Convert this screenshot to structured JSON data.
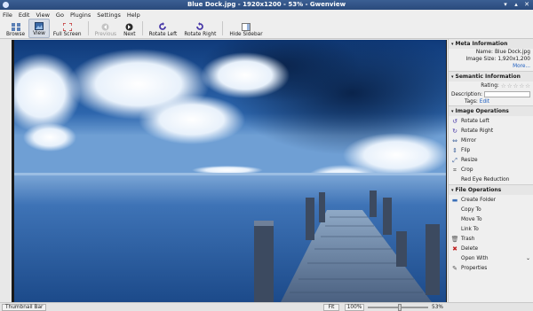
{
  "window": {
    "title": "Blue Dock.jpg - 1920x1200 - 53% - Gwenview"
  },
  "menu": [
    "File",
    "Edit",
    "View",
    "Go",
    "Plugins",
    "Settings",
    "Help"
  ],
  "toolbar": {
    "browse": "Browse",
    "view": "View",
    "fullscreen": "Full Screen",
    "previous": "Previous",
    "next": "Next",
    "rotate_left": "Rotate Left",
    "rotate_right": "Rotate Right",
    "hide_sidebar": "Hide Sidebar"
  },
  "sidebar": {
    "meta": {
      "header": "Meta Information",
      "name_label": "Name:",
      "name_value": "Blue Dock.jpg",
      "size_label": "Image Size:",
      "size_value": "1,920x1,200",
      "more": "More..."
    },
    "semantic": {
      "header": "Semantic Information",
      "rating_label": "Rating:",
      "rating_value": 0,
      "description_label": "Description:",
      "tags_label": "Tags:",
      "tags_edit": "Edit"
    },
    "image_ops": {
      "header": "Image Operations",
      "items": [
        "Rotate Left",
        "Rotate Right",
        "Mirror",
        "Flip",
        "Resize",
        "Crop",
        "Red Eye Reduction"
      ]
    },
    "file_ops": {
      "header": "File Operations",
      "items": [
        "Create Folder",
        "Copy To",
        "Move To",
        "Link To",
        "Trash",
        "Delete",
        "Open With",
        "Properties"
      ]
    }
  },
  "statusbar": {
    "thumbnail_bar": "Thumbnail Bar",
    "fit": "Fit",
    "zoom_100": "100%",
    "zoom_percent": "53%",
    "zoom_level": 0.53
  },
  "colors": {
    "titlebar": "#2a4a7c",
    "link": "#2060c0"
  }
}
